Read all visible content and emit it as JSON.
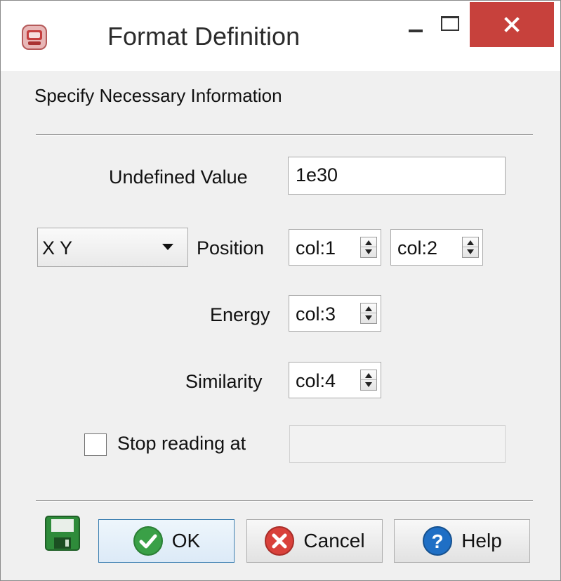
{
  "window": {
    "title": "Format Definition",
    "icon": "app-icon",
    "controls": {
      "minimize": "minimize-icon",
      "maximize": "maximize-icon",
      "close": "close-icon"
    },
    "close_color": "#c7413c"
  },
  "section": {
    "title": "Specify Necessary Information"
  },
  "fields": {
    "undefined_label": "Undefined Value",
    "undefined_value": "1e30",
    "coord_mode": "X Y",
    "position_label": "Position",
    "position_x": "col:1",
    "position_y": "col:2",
    "energy_label": "Energy",
    "energy_value": "col:3",
    "similarity_label": "Similarity",
    "similarity_value": "col:4",
    "stop_label": "Stop reading at",
    "stop_value": "",
    "stop_checked": false
  },
  "buttons": {
    "save_icon": "save-icon",
    "ok": "OK",
    "cancel": "Cancel",
    "help": "Help"
  },
  "colors": {
    "ok_icon": "#3aa047",
    "cancel_icon": "#d9413b",
    "help_icon": "#1f6fc5",
    "save_icon": "#2e8b3a"
  }
}
